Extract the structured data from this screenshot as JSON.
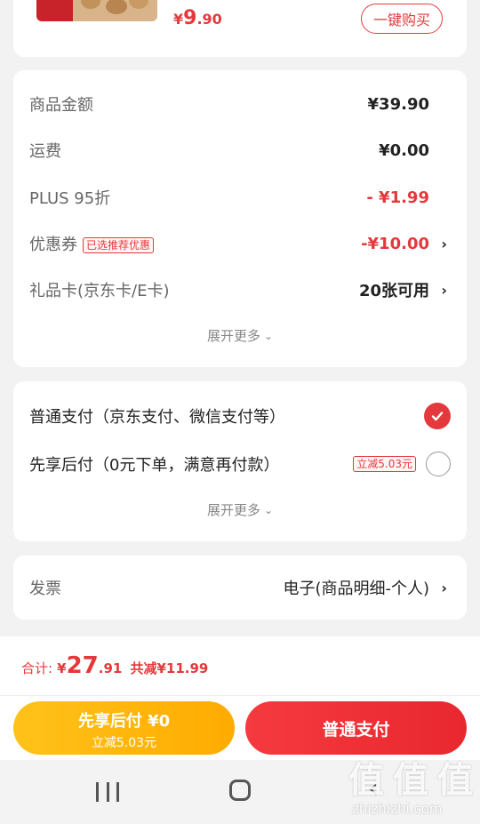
{
  "product": {
    "price_symbol": "¥",
    "price_int": "9",
    "price_dec": ".90",
    "buy_button": "一键购买"
  },
  "summary": {
    "rows": [
      {
        "label": "商品金额",
        "value": "¥39.90"
      },
      {
        "label": "运费",
        "value": "¥0.00"
      },
      {
        "label": "PLUS 95折",
        "value": "- ¥1.99"
      },
      {
        "label": "优惠券",
        "tag": "已选推荐优惠",
        "value": "-¥10.00"
      },
      {
        "label": "礼品卡(京东卡/E卡)",
        "value": "20张可用"
      }
    ],
    "more": "展开更多"
  },
  "payment": {
    "options": [
      {
        "label": "普通支付（京东支付、微信支付等）"
      },
      {
        "label": "先享后付（0元下单，满意再付款）",
        "tag": "立减5.03元"
      }
    ],
    "more": "展开更多"
  },
  "invoice": {
    "label": "发票",
    "value": "电子(商品明细-个人)"
  },
  "footer": {
    "total_label": "合计:",
    "symbol": "¥",
    "total_int": "27",
    "total_dec": ".91",
    "discount": "共减¥11.99",
    "btn_later_main": "先享后付 ¥0",
    "btn_later_sub": "立减5.03元",
    "btn_pay": "普通支付"
  },
  "watermark": {
    "text": "值 值 值",
    "site": "zhizhizhi.com"
  },
  "colors": {
    "accent": "#e4393c",
    "yellow": "#ffb300"
  }
}
